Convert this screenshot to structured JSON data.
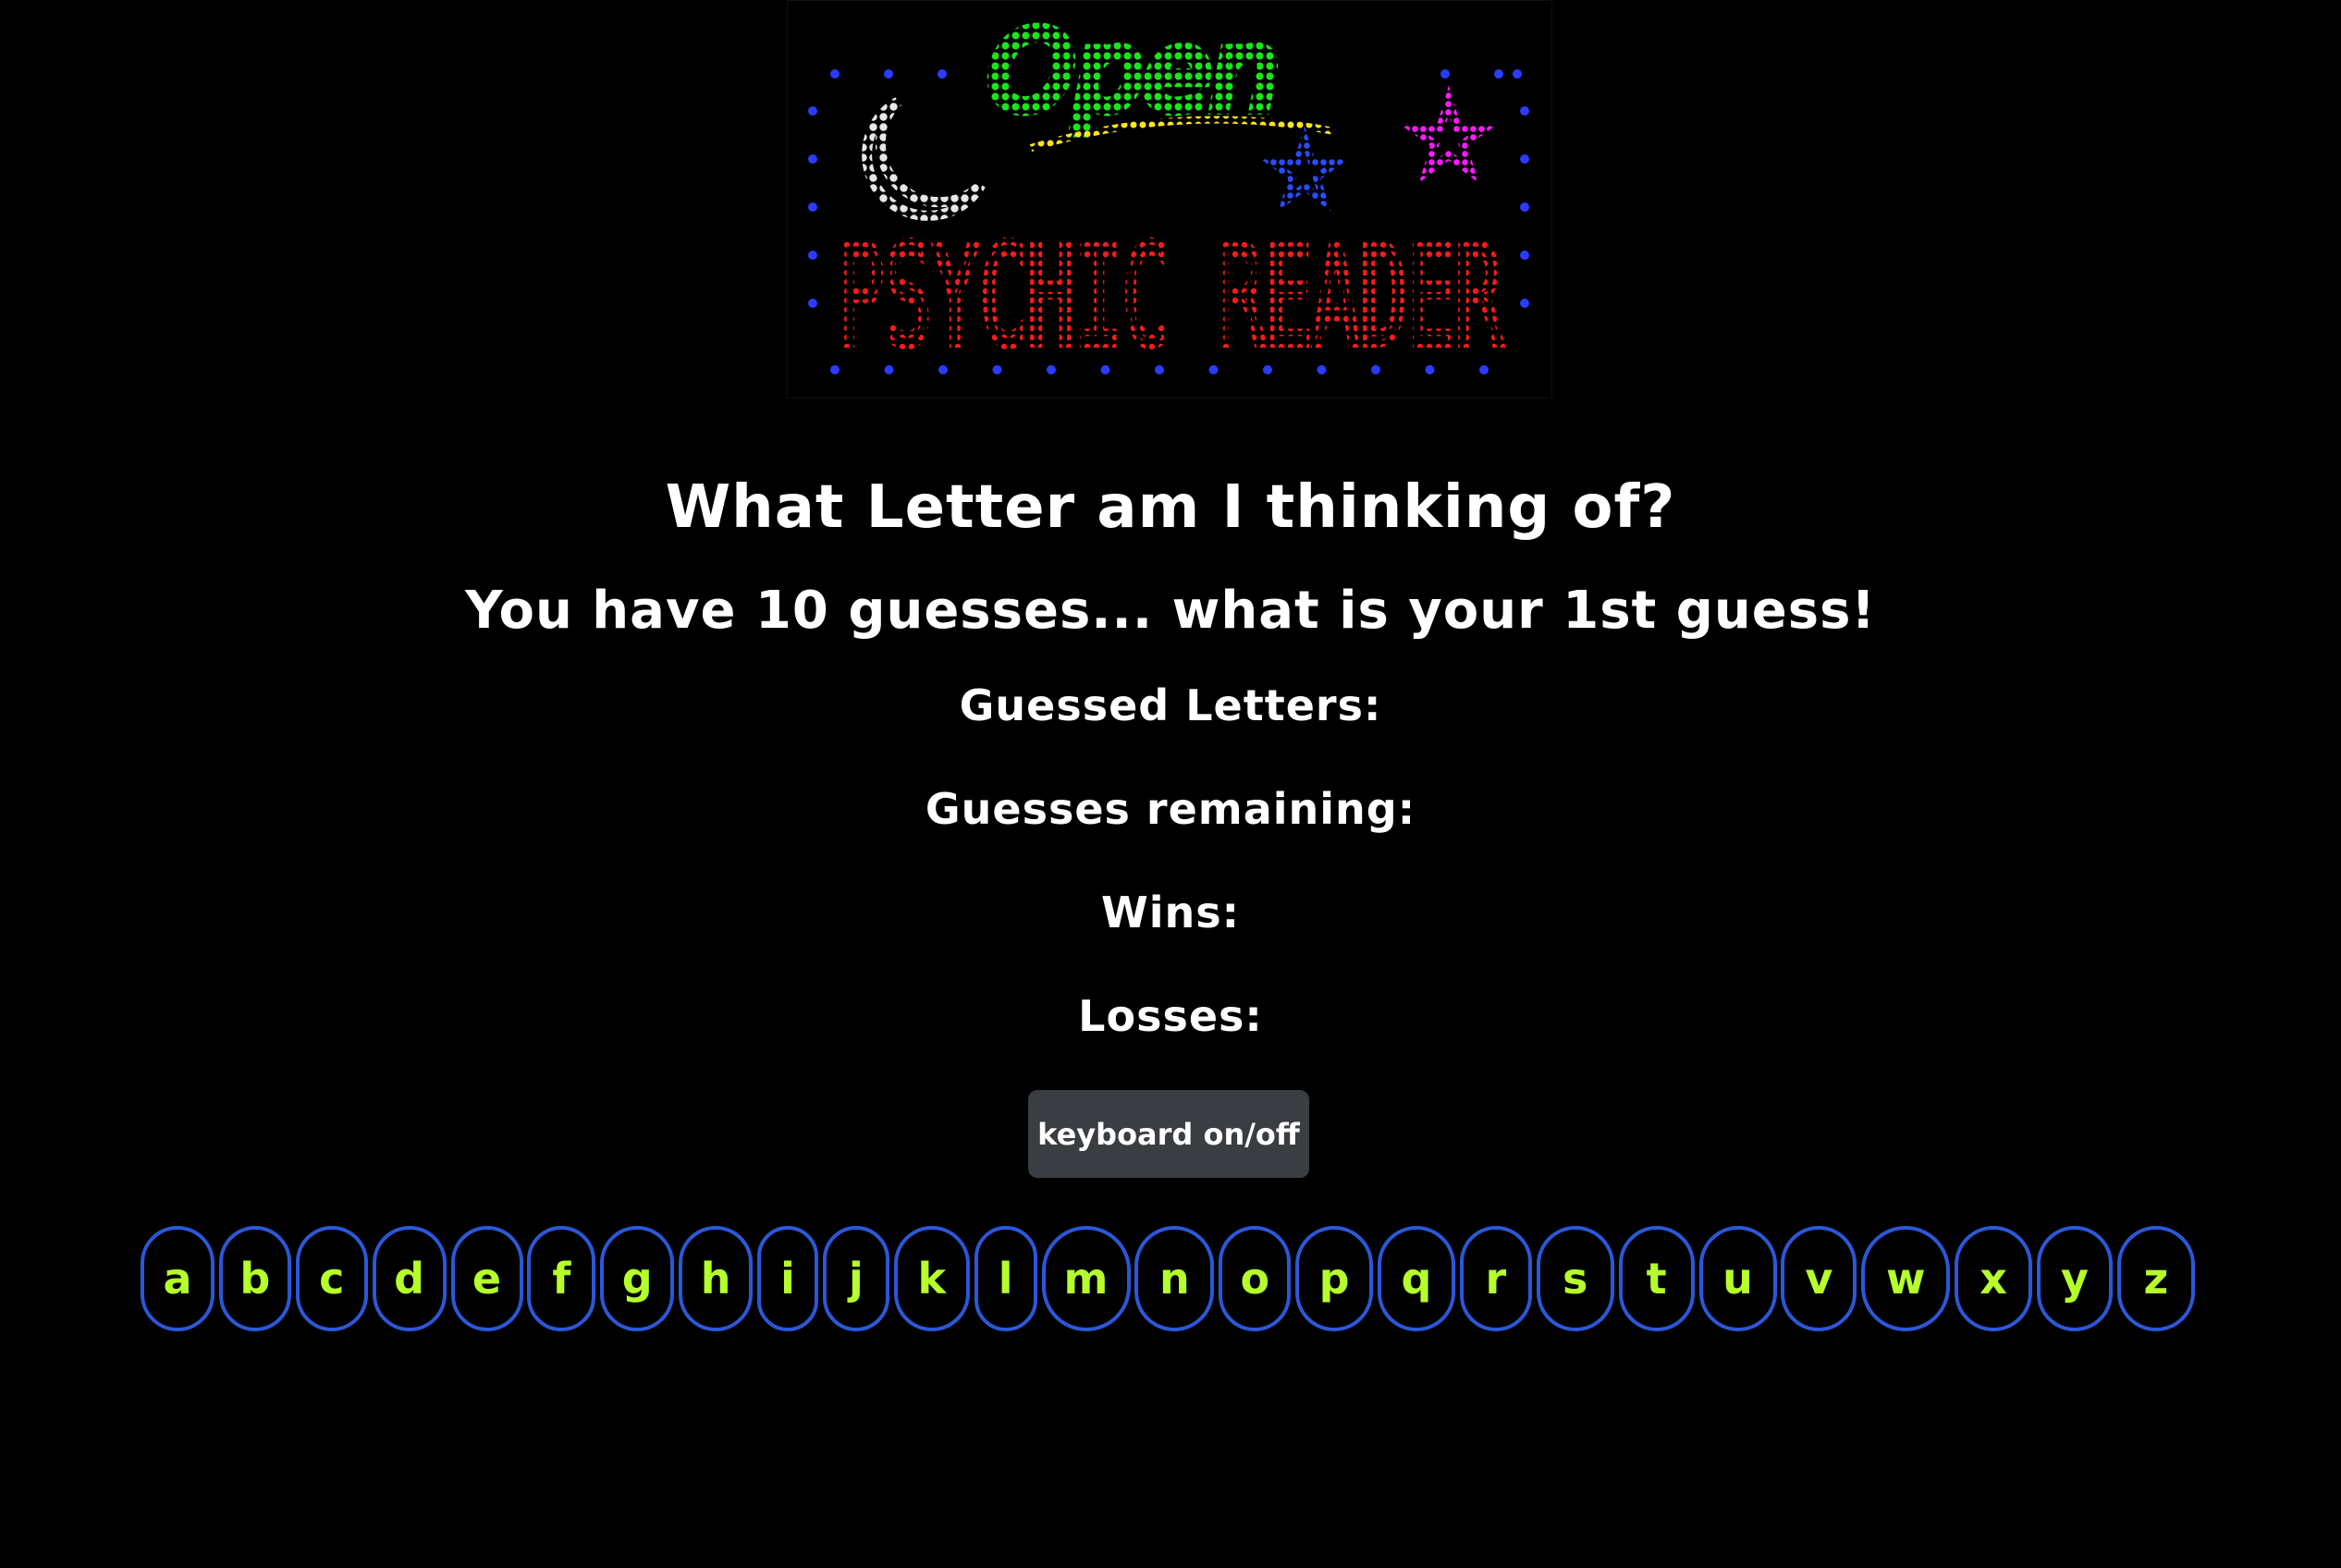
{
  "sign": {
    "open_text": "Open",
    "title_text": "PSYCHIC READER",
    "colors": {
      "open": "#19e619",
      "underline": "#ffe51a",
      "moon": "#e6e6e6",
      "title": "#ff1a1a",
      "border_dots": "#2a3cff",
      "star_pink": "#ff1aff",
      "star_blue": "#2a4cff"
    }
  },
  "game": {
    "question": "What Letter am I thinking of?",
    "prompt": "You have 10 guesses... what is your 1st guess!",
    "guessed_label": "Guessed Letters:",
    "remaining_label": "Guesses remaining:",
    "wins_label": "Wins:",
    "losses_label": "Losses:"
  },
  "controls": {
    "keyboard_toggle_label": "keyboard on/off"
  },
  "keyboard": {
    "keys": [
      "a",
      "b",
      "c",
      "d",
      "e",
      "f",
      "g",
      "h",
      "i",
      "j",
      "k",
      "l",
      "m",
      "n",
      "o",
      "p",
      "q",
      "r",
      "s",
      "t",
      "u",
      "v",
      "w",
      "x",
      "y",
      "z"
    ],
    "key_text_color": "#b5ff2a",
    "key_border_color": "#2b58d8"
  }
}
